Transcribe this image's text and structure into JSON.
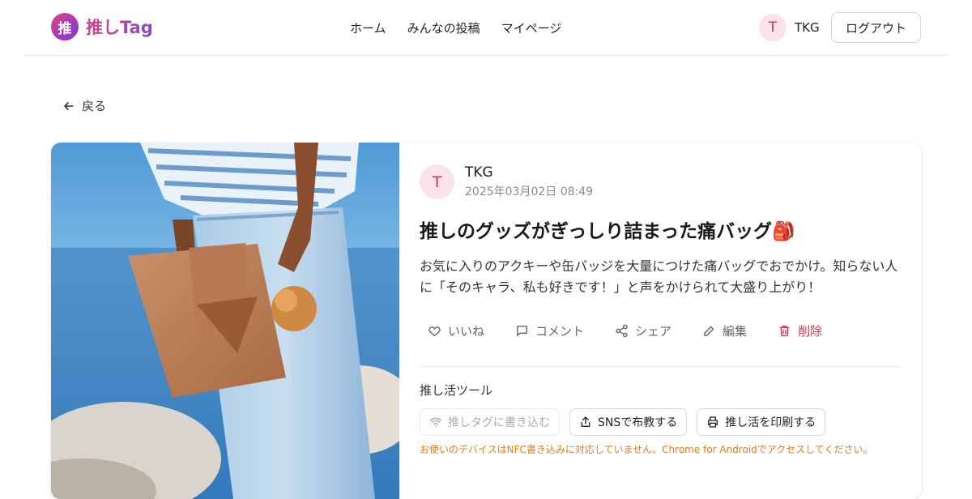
{
  "header": {
    "logo_mark": "推",
    "logo_text": "推しTag",
    "nav": [
      "ホーム",
      "みんなの投稿",
      "マイページ"
    ],
    "user_initial": "T",
    "user_name": "TKG",
    "logout_label": "ログアウト"
  },
  "back_label": "戻る",
  "post": {
    "author_initial": "T",
    "author_name": "TKG",
    "date": "2025年03月02日 08:49",
    "title": "推しのグッズがぎっしり詰まった痛バッグ🎒",
    "body": "お気に入りのアクキーや缶バッジを大量につけた痛バッグでおでかけ。知らない人に「そのキャラ、私も好きです！」と声をかけられて大盛り上がり！",
    "actions": {
      "like": "いいね",
      "comment": "コメント",
      "share": "シェア",
      "edit": "編集",
      "delete": "削除"
    }
  },
  "tools": {
    "label": "推し活ツール",
    "nfc_write": "推しタグに書き込む",
    "sns_share": "SNSで布教する",
    "print": "推し活を印刷する",
    "nfc_note": "お使いのデバイスはNFC書き込みに対応していません。Chrome for Androidでアクセスしてください。"
  },
  "colors": {
    "brand_pink": "#d3438a",
    "brand_purple": "#8a48c4",
    "delete_red": "#e0364a",
    "warning_orange": "#e07e1b",
    "avatar_bg": "#fbe3ea"
  },
  "icons": [
    "logo-icon",
    "arrow-left-icon",
    "heart-icon",
    "comment-icon",
    "share-icon",
    "edit-icon",
    "trash-icon",
    "nfc-icon",
    "upload-icon",
    "printer-icon"
  ]
}
